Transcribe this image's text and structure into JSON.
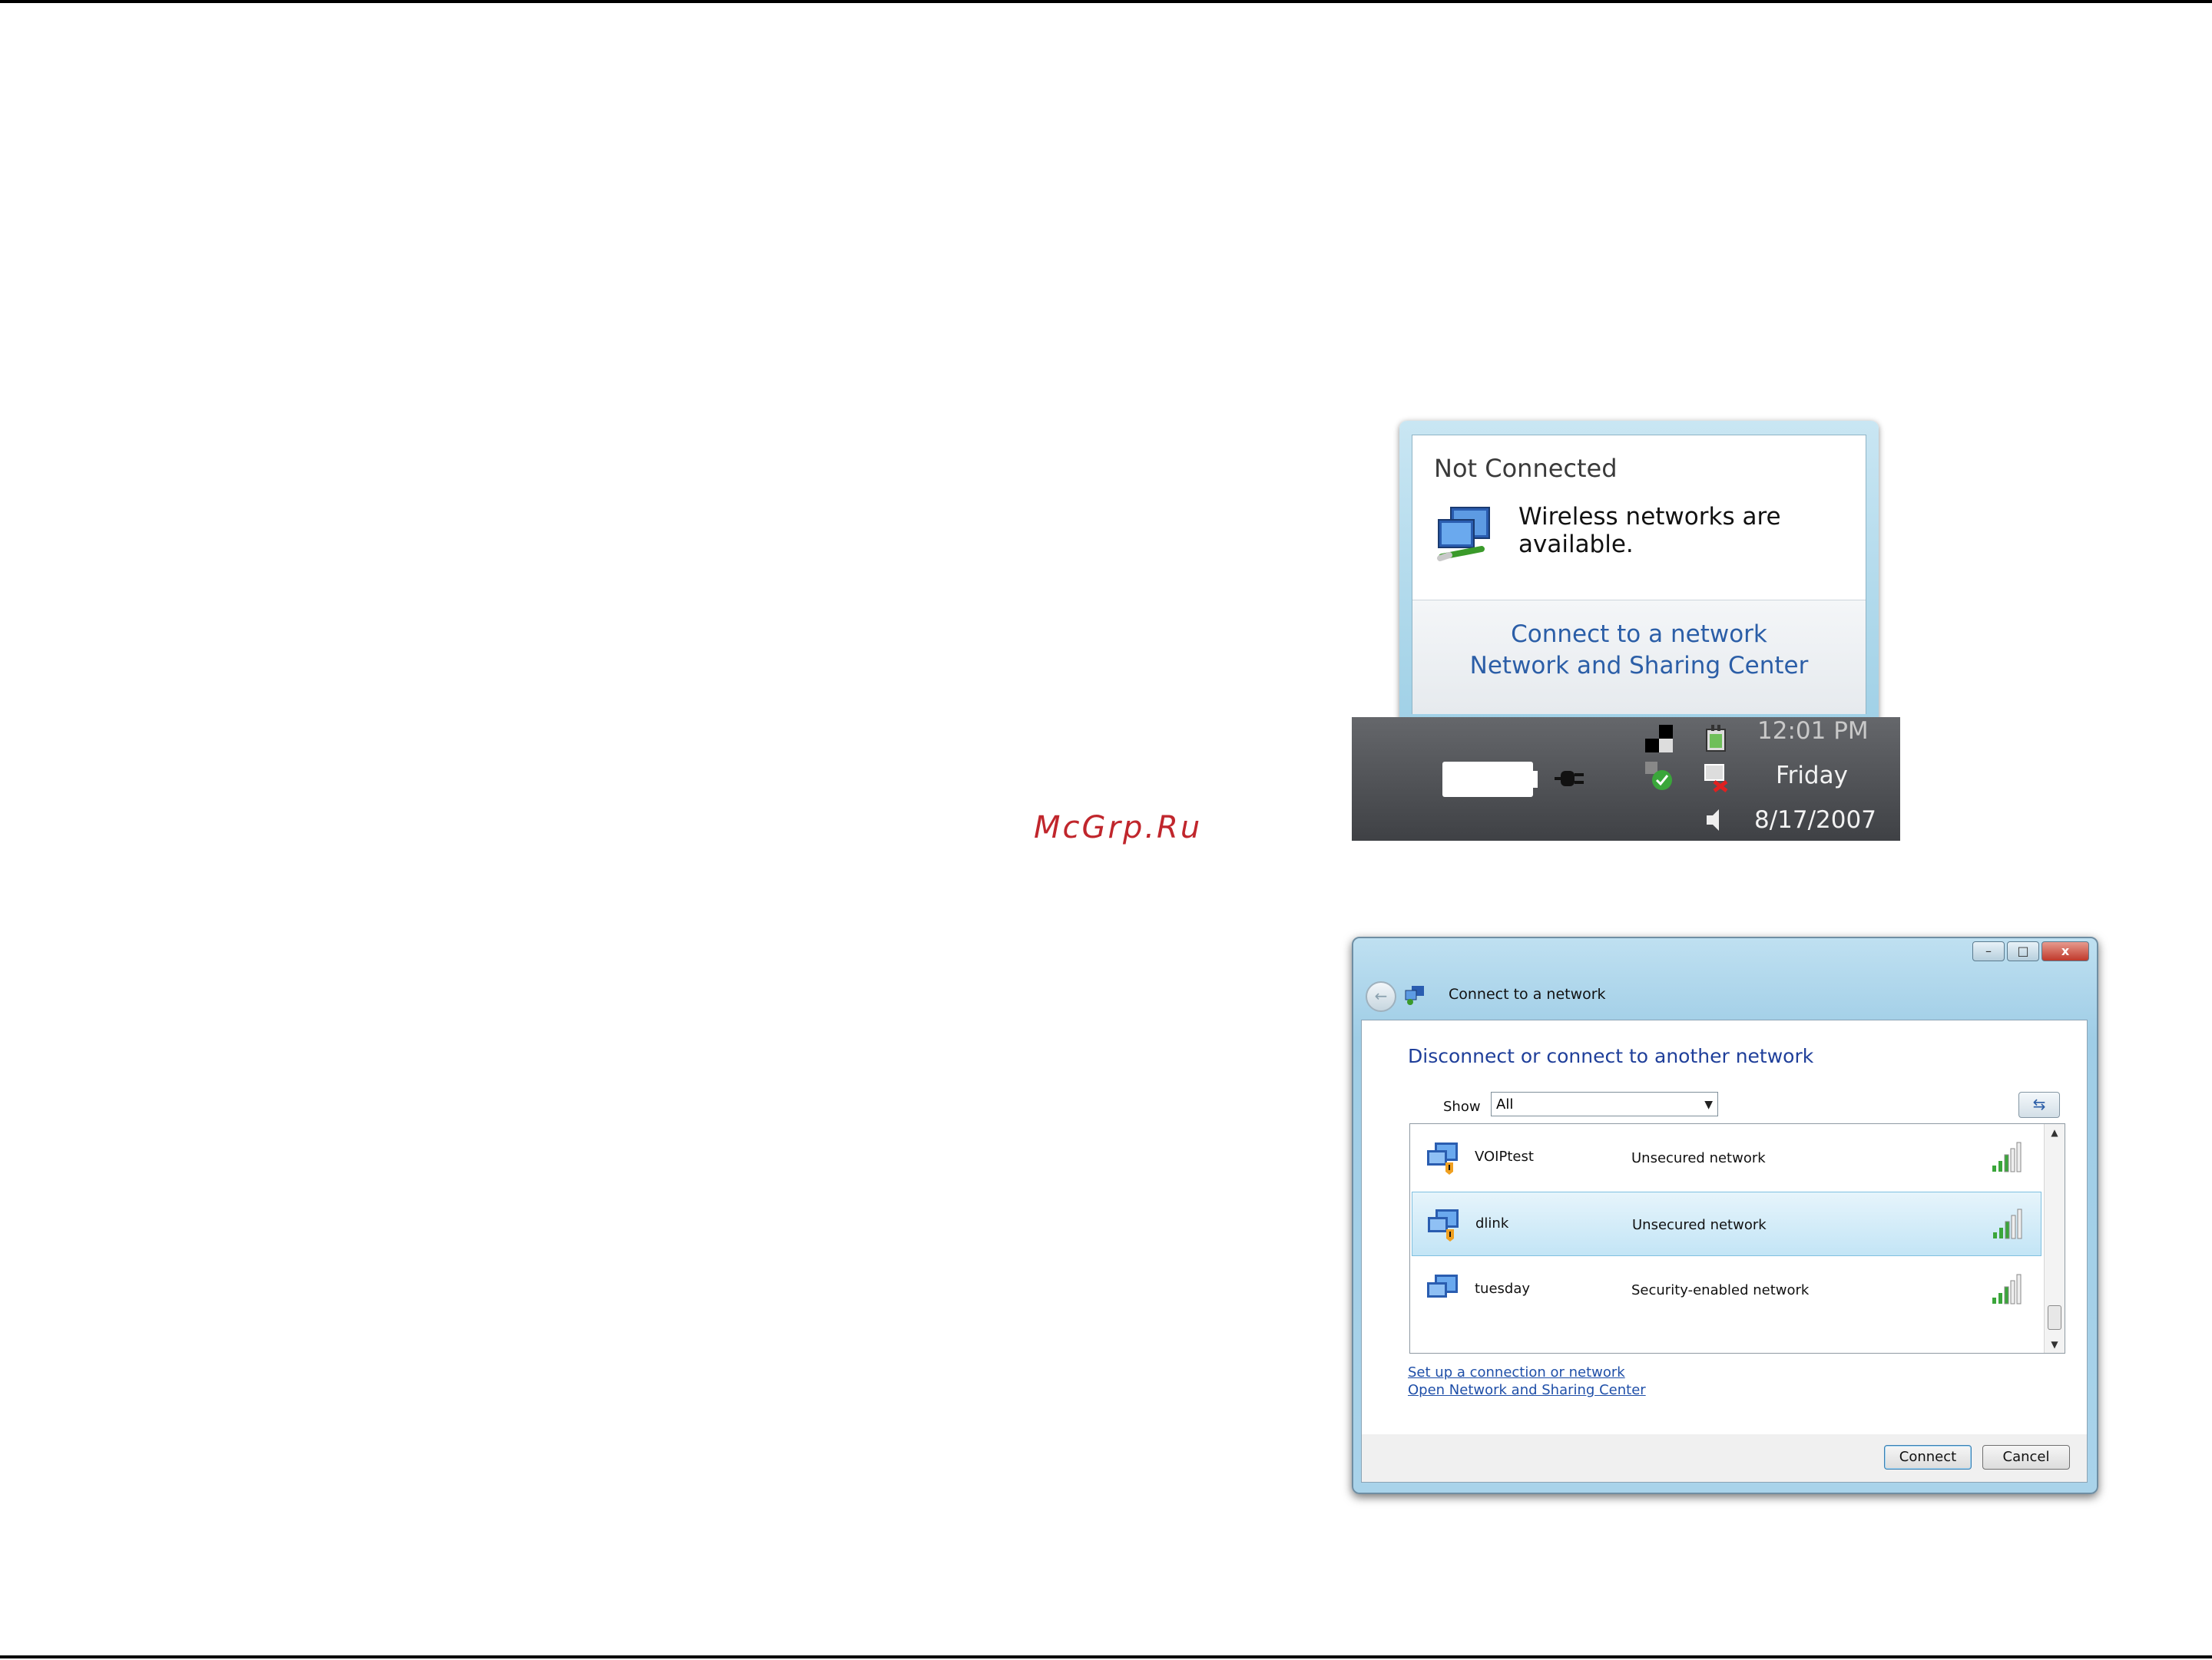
{
  "watermark": "McGrp.Ru",
  "tray_popup": {
    "title": "Not Connected",
    "message": "Wireless networks are available.",
    "links": [
      "Connect to a network",
      "Network and Sharing Center"
    ]
  },
  "taskbar": {
    "time": "12:01 PM",
    "day": "Friday",
    "date": "8/17/2007"
  },
  "dialog": {
    "window_title": "Connect to a network",
    "window_buttons": {
      "minimize": "–",
      "maximize": "□",
      "close": "x"
    },
    "heading": "Disconnect or connect to another network",
    "show_label": "Show",
    "show_value": "All",
    "networks": [
      {
        "name": "VOIPtest",
        "status": "Unsecured network",
        "signal_bars": 5,
        "selected": false
      },
      {
        "name": "dlink",
        "status": "Unsecured network",
        "signal_bars": 5,
        "selected": true
      },
      {
        "name": "tuesday",
        "status": "Security-enabled network",
        "signal_bars": 5,
        "selected": false
      }
    ],
    "links": [
      "Set up a connection or network",
      "Open Network and Sharing Center"
    ],
    "buttons": {
      "connect": "Connect",
      "cancel": "Cancel"
    }
  },
  "colors": {
    "link_blue": "#2b5ea7",
    "heading_blue": "#1f3f9a",
    "watermark_red": "#c0262c"
  }
}
